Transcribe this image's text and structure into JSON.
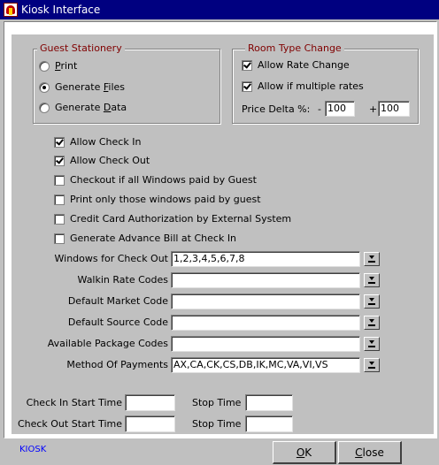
{
  "window": {
    "title": "Kiosk Interface"
  },
  "guest_stationery": {
    "title": "Guest Stationery",
    "options": [
      {
        "prefix": "",
        "u": "P",
        "rest": "rint",
        "selected": false
      },
      {
        "prefix": "Generate ",
        "u": "F",
        "rest": "iles",
        "selected": true
      },
      {
        "prefix": "Generate ",
        "u": "D",
        "rest": "ata",
        "selected": false
      }
    ]
  },
  "room_type_change": {
    "title": "Room Type Change",
    "allow_rate_change": {
      "label": "Allow Rate Change",
      "checked": true
    },
    "allow_multiple_rates": {
      "label": "Allow if multiple rates",
      "checked": true
    },
    "price_delta_label": "Price Delta %:",
    "minus_sign": "-",
    "plus_sign": "+",
    "minus_value": "100",
    "plus_value": "100"
  },
  "checkboxes": [
    {
      "label": "Allow Check In",
      "checked": true
    },
    {
      "label": "Allow Check Out",
      "checked": true
    },
    {
      "label": "Checkout if all Windows paid by Guest",
      "checked": false
    },
    {
      "label": "Print only those windows paid by guest",
      "checked": false
    },
    {
      "label": "Credit Card Authorization by External System",
      "checked": false
    },
    {
      "label": "Generate Advance Bill at Check In",
      "checked": false
    }
  ],
  "fields": [
    {
      "label": "Windows for Check Out",
      "value": "1,2,3,4,5,6,7,8"
    },
    {
      "label": "Walkin Rate Codes",
      "value": ""
    },
    {
      "label": "Default Market Code",
      "value": ""
    },
    {
      "label": "Default Source Code",
      "value": ""
    },
    {
      "label": "Available Package Codes",
      "value": ""
    },
    {
      "label": "Method Of Payments",
      "value": "AX,CA,CK,CS,DB,IK,MC,VA,VI,VS"
    }
  ],
  "times": {
    "check_in_start_label": "Check In Start Time",
    "check_out_start_label": "Check Out Start Time",
    "stop_time_label": "Stop Time",
    "check_in_start": "",
    "check_in_stop": "",
    "check_out_start": "",
    "check_out_stop": ""
  },
  "footer": {
    "status_label": "KIOSK",
    "ok": {
      "u": "O",
      "rest": "K"
    },
    "close": {
      "u": "C",
      "rest": "lose"
    }
  },
  "colors": {
    "titlebar": "#000080",
    "group_title": "#800000",
    "status": "#0000ff"
  }
}
